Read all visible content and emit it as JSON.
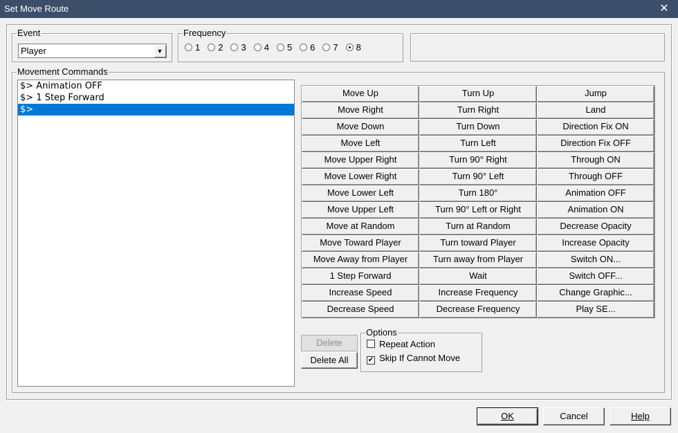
{
  "window": {
    "title": "Set Move Route",
    "close_glyph": "✕"
  },
  "event": {
    "legend": "Event",
    "selected": "Player",
    "arrow": "▼"
  },
  "frequency": {
    "legend": "Frequency",
    "options": [
      {
        "label": "1",
        "checked": false
      },
      {
        "label": "2",
        "checked": false
      },
      {
        "label": "3",
        "checked": false
      },
      {
        "label": "4",
        "checked": false
      },
      {
        "label": "5",
        "checked": false
      },
      {
        "label": "6",
        "checked": false
      },
      {
        "label": "7",
        "checked": false
      },
      {
        "label": "8",
        "checked": true
      }
    ]
  },
  "movement": {
    "legend": "Movement Commands",
    "list": [
      {
        "text": "$> Animation OFF",
        "selected": false
      },
      {
        "text": "$> 1 Step Forward",
        "selected": false
      },
      {
        "text": "$>",
        "selected": true
      }
    ],
    "commands": [
      "Move Up",
      "Turn Up",
      "Jump",
      "Move Right",
      "Turn Right",
      "Land",
      "Move Down",
      "Turn Down",
      "Direction Fix ON",
      "Move Left",
      "Turn Left",
      "Direction Fix OFF",
      "Move Upper Right",
      "Turn 90° Right",
      "Through ON",
      "Move Lower Right",
      "Turn 90° Left",
      "Through OFF",
      "Move Lower Left",
      "Turn 180°",
      "Animation OFF",
      "Move Upper Left",
      "Turn 90° Left or Right",
      "Animation ON",
      "Move at Random",
      "Turn at Random",
      "Decrease Opacity",
      "Move Toward Player",
      "Turn toward Player",
      "Increase Opacity",
      "Move Away from Player",
      "Turn away from Player",
      "Switch ON...",
      "1 Step Forward",
      "Wait",
      "Switch OFF...",
      "Increase Speed",
      "Increase Frequency",
      "Change Graphic...",
      "Decrease Speed",
      "Decrease Frequency",
      "Play SE..."
    ],
    "delete_label": "Delete",
    "delete_all_label": "Delete All"
  },
  "options": {
    "legend": "Options",
    "repeat_label": "Repeat Action",
    "repeat_checked": false,
    "skip_label": "Skip If Cannot Move",
    "skip_checked": true,
    "check_glyph": "✔"
  },
  "footer": {
    "ok_label": "OK",
    "cancel_label": "Cancel",
    "help_label": "Help"
  }
}
